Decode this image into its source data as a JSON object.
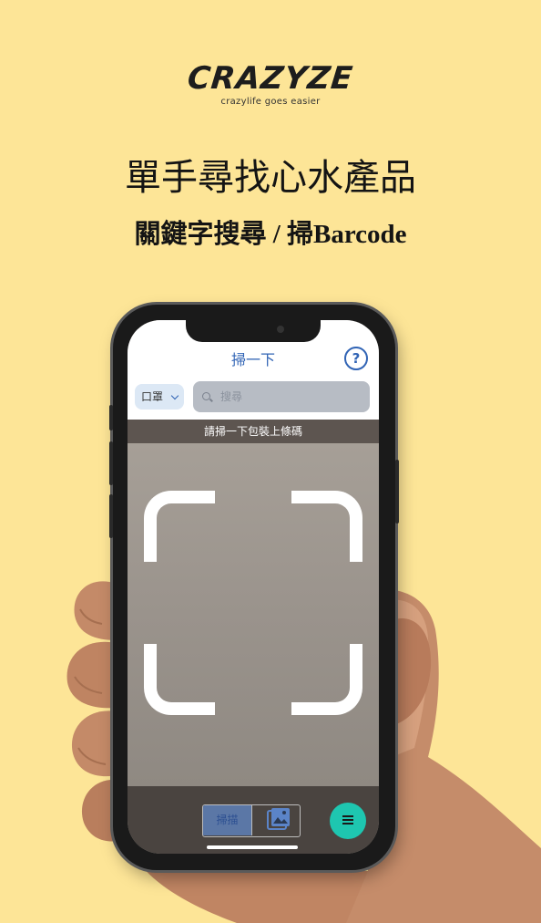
{
  "brand": {
    "logo_text": "CRAZYZE",
    "tagline": "crazylife goes easier"
  },
  "headline": "單手尋找心水產品",
  "subheadline": "關鍵字搜尋 / 掃Barcode",
  "app": {
    "title": "掃一下",
    "help_icon": "question-circle-icon",
    "category": "口罩",
    "search_placeholder": "搜尋",
    "instruction": "請掃一下包裝上條碼",
    "scan_tab_label": "掃描",
    "gallery_icon": "image-gallery-icon",
    "menu_icon": "menu-icon"
  },
  "colors": {
    "background": "#fde597",
    "accent": "#3164b5",
    "fab": "#1ec6b0"
  }
}
